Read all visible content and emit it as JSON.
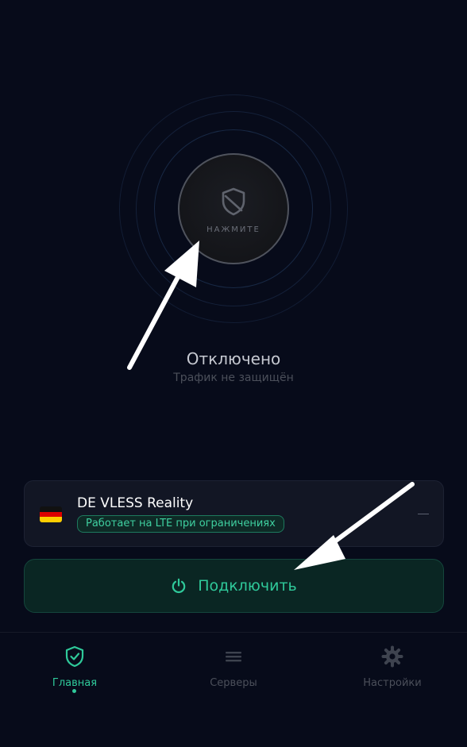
{
  "main": {
    "power_button_label": "НАЖМИТЕ",
    "status_title": "Отключено",
    "status_subtitle": "Трафик не защищён"
  },
  "server": {
    "flag": "germany-flag",
    "name": "DE VLESS Reality",
    "badge": "Работает на LTE при ограничениях"
  },
  "connect_button": {
    "label": "Подключить",
    "icon": "power-icon"
  },
  "nav": {
    "items": [
      {
        "label": "Главная",
        "icon": "shield-check-icon",
        "active": true
      },
      {
        "label": "Серверы",
        "icon": "menu-icon",
        "active": false
      },
      {
        "label": "Настройки",
        "icon": "gear-icon",
        "active": false
      }
    ]
  },
  "colors": {
    "background": "#070b1a",
    "accent": "#2fc99a",
    "inactive": "#4b4f5a"
  }
}
